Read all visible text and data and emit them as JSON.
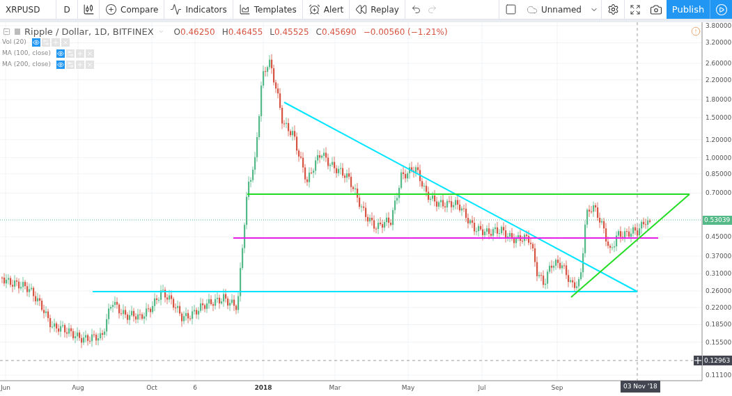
{
  "toolbar": {
    "symbol": "XRPUSD",
    "interval": "D",
    "buttons": [
      {
        "kind": "compare",
        "label": "Compare"
      },
      {
        "kind": "indicators",
        "label": "Indicators"
      },
      {
        "kind": "templates",
        "label": "Templates"
      },
      {
        "kind": "alert",
        "label": "Alert"
      },
      {
        "kind": "replay",
        "label": "Replay"
      }
    ],
    "history": [
      {
        "kind": "undo",
        "disabled": false
      },
      {
        "kind": "redo",
        "disabled": true
      }
    ],
    "layout_name": "Unnamed",
    "publish_label": "Publish"
  },
  "legend": {
    "title": "Ripple / Dollar, 1D, BITFINEX",
    "ohlc": [
      {
        "key": "O",
        "value": "0.46250"
      },
      {
        "key": "H",
        "value": "0.46455"
      },
      {
        "key": "L",
        "value": "0.45525"
      },
      {
        "key": "C",
        "value": "0.45690"
      }
    ],
    "change": "−0.00560 (−1.21%)"
  },
  "indicators": [
    {
      "label": "Vol (20)"
    },
    {
      "label": "MA (100, close)"
    },
    {
      "label": "MA (200, close)"
    }
  ],
  "price_axis": {
    "ticks": [
      "3.80000",
      "3.20000",
      "2.60000",
      "2.20000",
      "1.80000",
      "1.50000",
      "1.20000",
      "1.00000",
      "0.85000",
      "0.70000",
      "0.45000",
      "0.37000",
      "0.31000",
      "0.26000",
      "0.22000",
      "0.18500",
      "0.15500",
      "0.11100"
    ],
    "last_price": "0.53039",
    "crosshair_price": "0.12963"
  },
  "time_axis": {
    "ticks": [
      {
        "label": "Jun",
        "bold": false
      },
      {
        "label": "Aug",
        "bold": false
      },
      {
        "label": "Oct",
        "bold": false
      },
      {
        "label": "6",
        "bold": false
      },
      {
        "label": "2018",
        "bold": true
      },
      {
        "label": "Mar",
        "bold": false
      },
      {
        "label": "May",
        "bold": false
      },
      {
        "label": "Jul",
        "bold": false
      },
      {
        "label": "Sep",
        "bold": false
      }
    ],
    "crosshair_date": "03 Nov '18"
  }
}
